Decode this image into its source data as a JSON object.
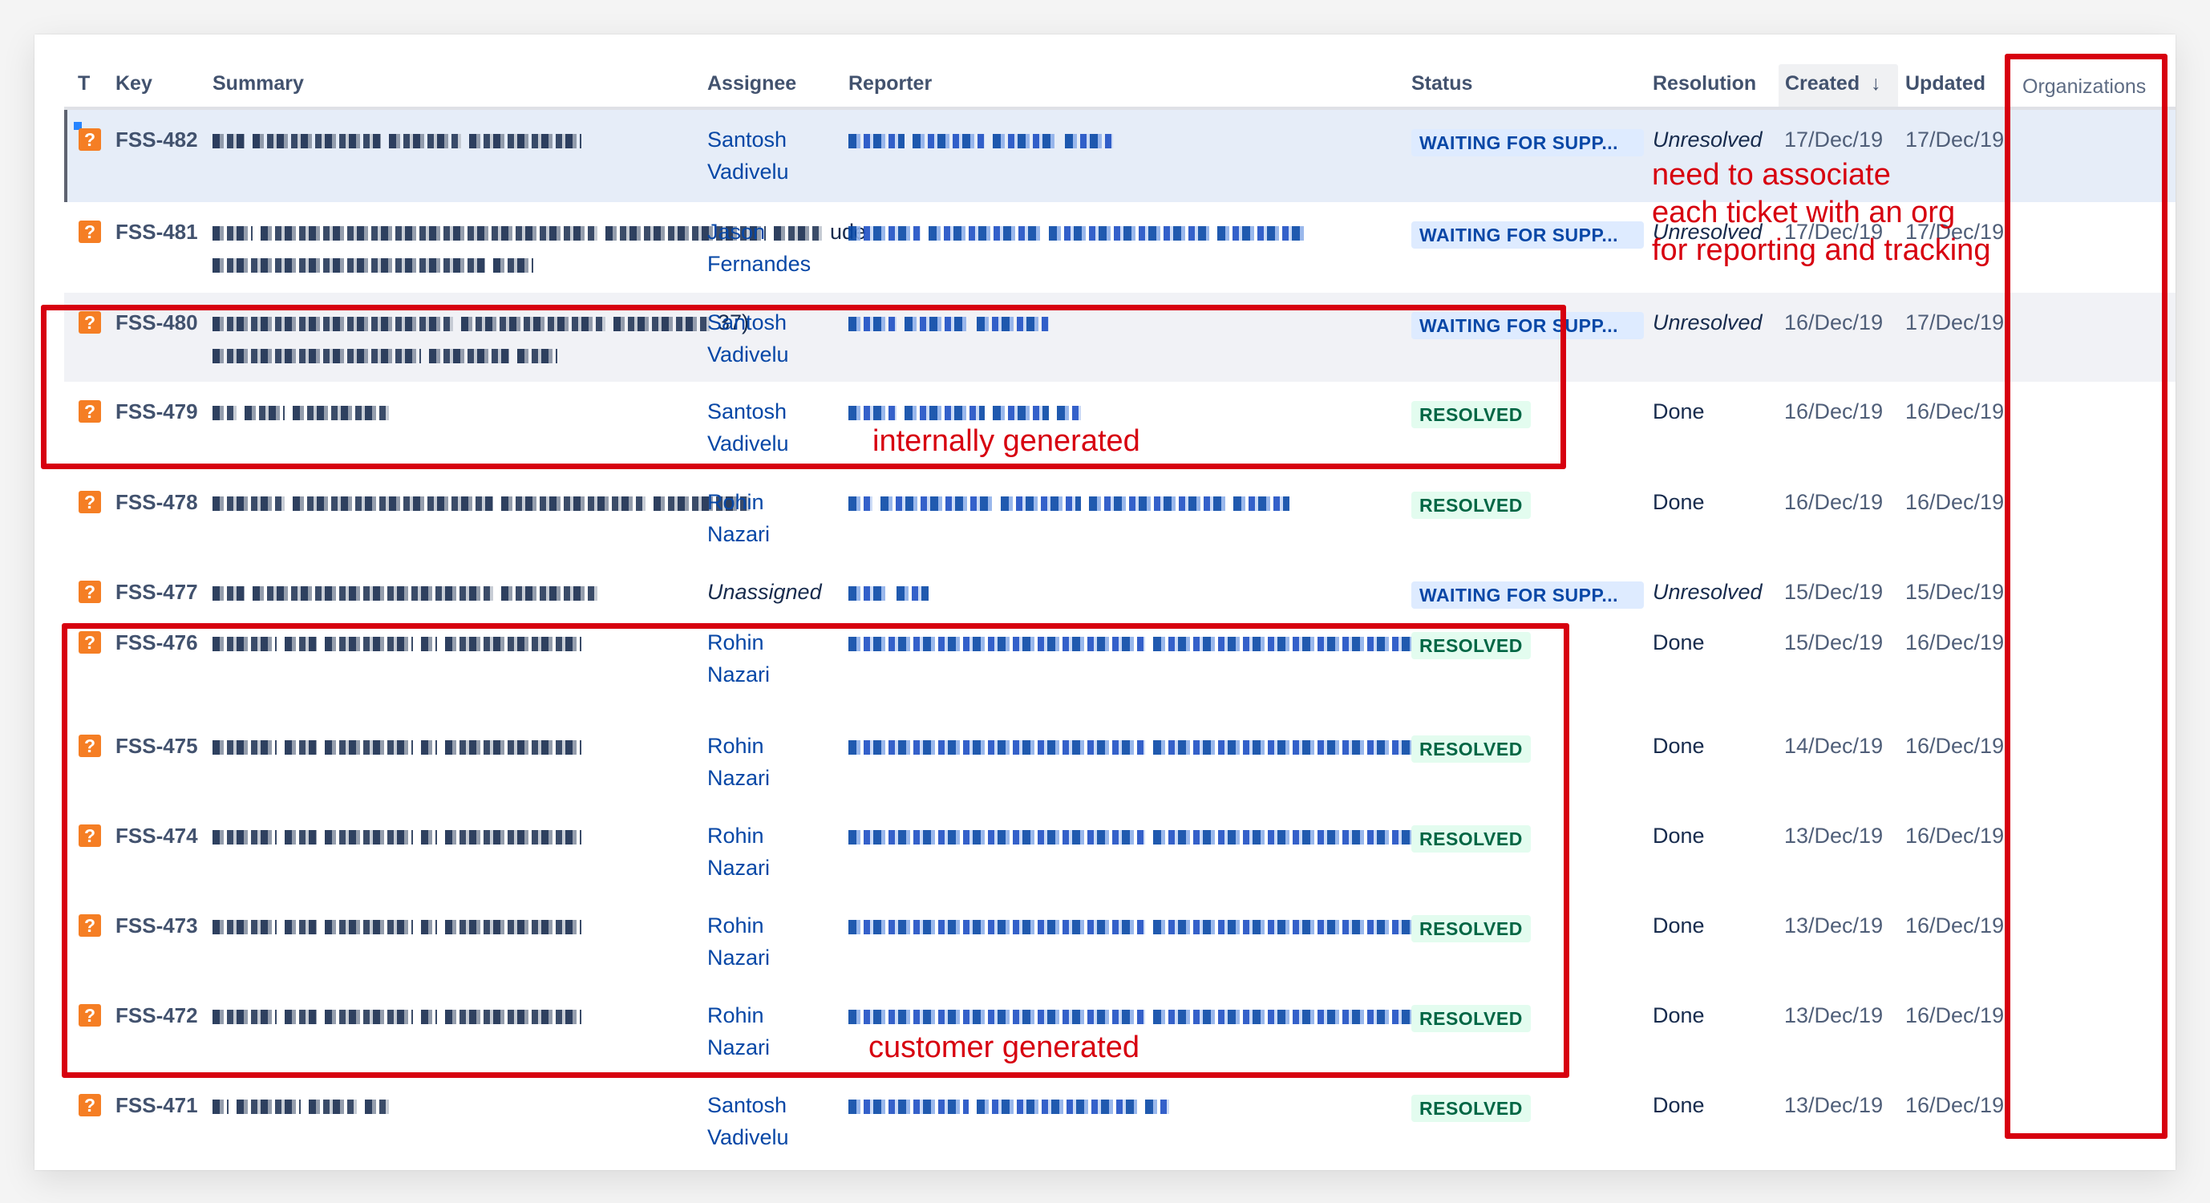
{
  "columns": {
    "type": "T",
    "key": "Key",
    "summary": "Summary",
    "assignee": "Assignee",
    "reporter": "Reporter",
    "status": "Status",
    "resolution": "Resolution",
    "created": "Created",
    "created_sort_icon": "↓",
    "updated": "Updated",
    "organizations": "Organizations"
  },
  "issue_type_icon": "?",
  "rows": [
    {
      "key": "FSS-482",
      "summary_redacted": true,
      "assignee": "Santosh Vadivelu",
      "assignee_l1": "Santosh",
      "assignee_l2": "Vadivelu",
      "reporter_redacted": true,
      "status": "WAITING FOR SUPP...",
      "resolution": "Unresolved",
      "created": "17/Dec/19",
      "updated": "17/Dec/19",
      "organizations": ""
    },
    {
      "key": "FSS-481",
      "summary_tail": "ude",
      "summary_redacted": true,
      "assignee": "Jason Fernandes",
      "assignee_l1": "Jason",
      "assignee_l2": "Fernandes",
      "reporter_redacted": true,
      "status": "WAITING FOR SUPP...",
      "resolution": "Unresolved",
      "created": "17/Dec/19",
      "updated": "17/Dec/19",
      "organizations": ""
    },
    {
      "key": "FSS-480",
      "summary_tail": "37)",
      "summary_redacted": true,
      "assignee": "Santosh Vadivelu",
      "assignee_l1": "Santosh",
      "assignee_l2": "Vadivelu",
      "reporter_redacted": true,
      "status": "WAITING FOR SUPP...",
      "resolution": "Unresolved",
      "created": "16/Dec/19",
      "updated": "17/Dec/19",
      "organizations": ""
    },
    {
      "key": "FSS-479",
      "summary_redacted": true,
      "assignee": "Santosh Vadivelu",
      "assignee_l1": "Santosh",
      "assignee_l2": "Vadivelu",
      "reporter_redacted": true,
      "status": "RESOLVED",
      "resolution": "Done",
      "created": "16/Dec/19",
      "updated": "16/Dec/19",
      "organizations": ""
    },
    {
      "key": "FSS-478",
      "summary_redacted": true,
      "assignee": "Rohin Nazari",
      "assignee_l1": "Rohin",
      "assignee_l2": "Nazari",
      "reporter_redacted": true,
      "status": "RESOLVED",
      "resolution": "Done",
      "created": "16/Dec/19",
      "updated": "16/Dec/19",
      "organizations": ""
    },
    {
      "key": "FSS-477",
      "summary_redacted": true,
      "assignee": "Unassigned",
      "assignee_l1": "Unassigned",
      "assignee_l2": "",
      "reporter_redacted": true,
      "status": "WAITING FOR SUPP...",
      "resolution": "Unresolved",
      "created": "15/Dec/19",
      "updated": "15/Dec/19",
      "organizations": ""
    },
    {
      "key": "FSS-476",
      "summary_redacted": true,
      "assignee": "Rohin Nazari",
      "assignee_l1": "Rohin",
      "assignee_l2": "Nazari",
      "reporter_redacted": true,
      "status": "RESOLVED",
      "resolution": "Done",
      "created": "15/Dec/19",
      "updated": "16/Dec/19",
      "organizations": ""
    },
    {
      "key": "FSS-475",
      "summary_redacted": true,
      "assignee": "Rohin Nazari",
      "assignee_l1": "Rohin",
      "assignee_l2": "Nazari",
      "reporter_redacted": true,
      "status": "RESOLVED",
      "resolution": "Done",
      "created": "14/Dec/19",
      "updated": "16/Dec/19",
      "organizations": ""
    },
    {
      "key": "FSS-474",
      "summary_redacted": true,
      "assignee": "Rohin Nazari",
      "assignee_l1": "Rohin",
      "assignee_l2": "Nazari",
      "reporter_redacted": true,
      "status": "RESOLVED",
      "resolution": "Done",
      "created": "13/Dec/19",
      "updated": "16/Dec/19",
      "organizations": ""
    },
    {
      "key": "FSS-473",
      "summary_redacted": true,
      "assignee": "Rohin Nazari",
      "assignee_l1": "Rohin",
      "assignee_l2": "Nazari",
      "reporter_redacted": true,
      "status": "RESOLVED",
      "resolution": "Done",
      "created": "13/Dec/19",
      "updated": "16/Dec/19",
      "organizations": ""
    },
    {
      "key": "FSS-472",
      "summary_redacted": true,
      "assignee": "Rohin Nazari",
      "assignee_l1": "Rohin",
      "assignee_l2": "Nazari",
      "reporter_redacted": true,
      "status": "RESOLVED",
      "resolution": "Done",
      "created": "13/Dec/19",
      "updated": "16/Dec/19",
      "organizations": ""
    },
    {
      "key": "FSS-471",
      "summary_redacted": true,
      "assignee": "Santosh Vadivelu",
      "assignee_l1": "Santosh",
      "assignee_l2": "Vadivelu",
      "reporter_redacted": true,
      "status": "RESOLVED",
      "resolution": "Done",
      "created": "13/Dec/19",
      "updated": "16/Dec/19",
      "organizations": ""
    }
  ],
  "annotations": {
    "org_note_l1": "need to associate",
    "org_note_l2": "each ticket with an org",
    "org_note_l3": "for reporting and tracking",
    "internal_label": "internally generated",
    "customer_label": "customer generated"
  },
  "colors": {
    "annotation_red": "#d7000f",
    "waiting_bg": "#deebff",
    "waiting_fg": "#0747a6",
    "resolved_bg": "#e3fcef",
    "resolved_fg": "#006644",
    "issue_type": "#f57e24",
    "link": "#0747a6"
  }
}
